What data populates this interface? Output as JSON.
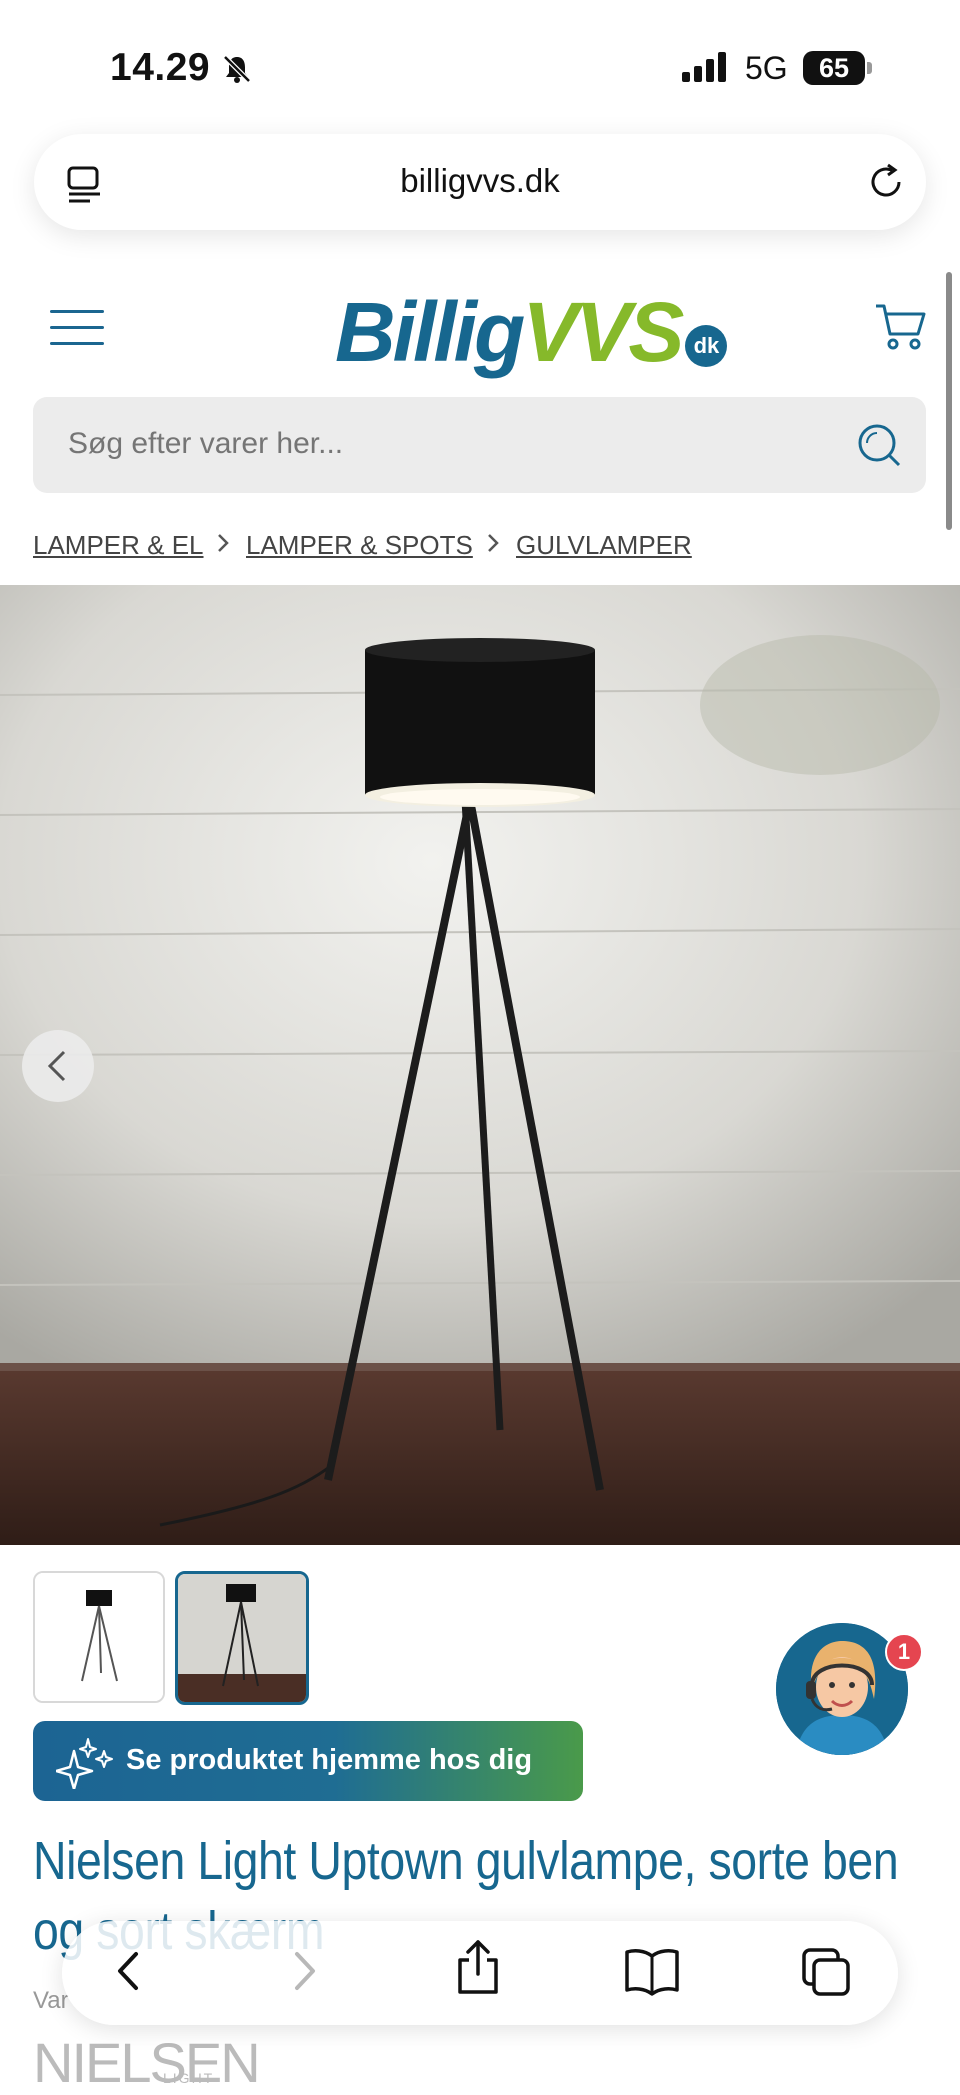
{
  "status_bar": {
    "time": "14.29",
    "network": "5G",
    "battery": "65"
  },
  "browser": {
    "url": "billigvvs.dk"
  },
  "site": {
    "logo_main": "Billig",
    "logo_accent": "VVS",
    "logo_badge": "dk",
    "search_placeholder": "Søg efter varer her..."
  },
  "breadcrumb": [
    "LAMPER & EL",
    "LAMPER & SPOTS",
    "GULVLAMPER"
  ],
  "product": {
    "ar_button": "Se produktet hjemme hos dig",
    "title": "Nielsen Light Uptown gulvlampe, sorte ben og sort skærm",
    "variant_label": "Var",
    "brand_name": "NIELSEN",
    "brand_sub": "LIGHT"
  },
  "chat": {
    "badge_count": "1"
  },
  "colors": {
    "brand_blue": "#17678f",
    "brand_green": "#86b92a",
    "badge_red": "#e54550"
  }
}
